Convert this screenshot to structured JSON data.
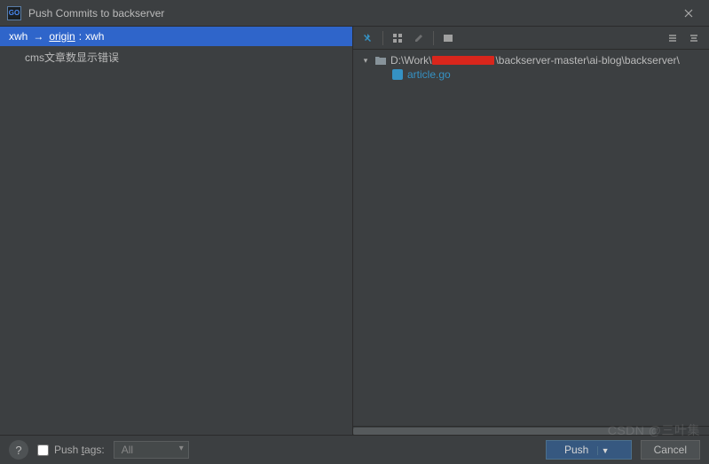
{
  "window": {
    "title": "Push Commits to backserver",
    "app_icon_text": "GO"
  },
  "left": {
    "branch_local": "xwh",
    "remote_label": "origin",
    "branch_remote": "xwh",
    "commit_message": "cms文章数显示错误"
  },
  "right": {
    "path_prefix": "D:\\Work\\",
    "path_suffix": "\\backserver-master\\ai-blog\\backserver\\",
    "file_name": "article.go"
  },
  "footer": {
    "push_tags_label": "Push tags:",
    "push_tags_value": "All",
    "push_label": "Push",
    "cancel_label": "Cancel"
  },
  "watermark": "CSDN @三叶集"
}
